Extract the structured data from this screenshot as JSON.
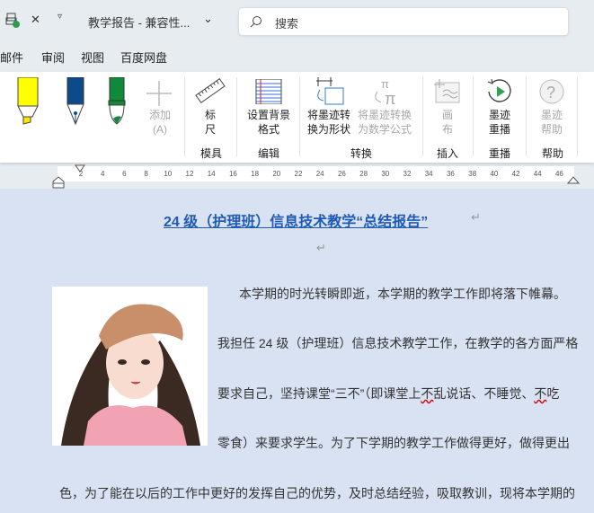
{
  "titlebar": {
    "doc_title": "教学报告 - 兼容性...",
    "search_placeholder": "搜索"
  },
  "tabs": [
    "邮件",
    "审阅",
    "视图",
    "百度网盘"
  ],
  "ribbon": {
    "add_label": "添加",
    "add_sub": "(A)",
    "ruler_label": [
      "标",
      "尺"
    ],
    "bg_label": [
      "设置背景",
      "格式"
    ],
    "to_shape": [
      "将墨迹转",
      "换为形状"
    ],
    "to_math": [
      "将墨迹转换",
      "为数学公式"
    ],
    "canvas": [
      "画",
      "布"
    ],
    "replay": [
      "墨迹",
      "重播"
    ],
    "help": [
      "墨迹",
      "帮助"
    ],
    "groups": [
      "模具",
      "编辑",
      "转换",
      "插入",
      "重播",
      "帮助"
    ]
  },
  "ruler_ticks": [
    "2",
    "4",
    "6",
    "8",
    "10",
    "12",
    "14",
    "16",
    "18",
    "20",
    "22",
    "24",
    "26",
    "28",
    "30",
    "32",
    "34",
    "36",
    "38",
    "40",
    "42",
    "44",
    "46"
  ],
  "document": {
    "title": "24 级（护理班）信息技术教学“总结报告”",
    "para_mark": "↵",
    "lines": [
      "本学期的时光转瞬即逝，本学期的教学工作即将落下帷幕。",
      "我担任 24 级（护理班）信息技术教学工作，在教学的各方面严格",
      "要求自己，坚持课堂“三不”（即课堂上",
      "不",
      "乱说话、不睡觉、",
      "不",
      "吃",
      "零食）来要求学生。为了下学期的教学工作做得更好，做得更出",
      "色，为了能在以后的工作中更好的发挥自己的优势，及时总结经验，吸取教训，现将本学期的"
    ]
  }
}
